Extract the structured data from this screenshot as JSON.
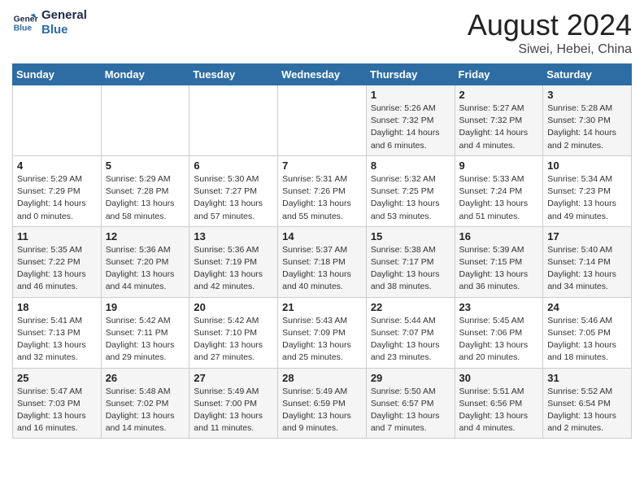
{
  "logo": {
    "line1": "General",
    "line2": "Blue"
  },
  "title": "August 2024",
  "location": "Siwei, Hebei, China",
  "weekdays": [
    "Sunday",
    "Monday",
    "Tuesday",
    "Wednesday",
    "Thursday",
    "Friday",
    "Saturday"
  ],
  "weeks": [
    [
      {
        "day": "",
        "info": ""
      },
      {
        "day": "",
        "info": ""
      },
      {
        "day": "",
        "info": ""
      },
      {
        "day": "",
        "info": ""
      },
      {
        "day": "1",
        "info": "Sunrise: 5:26 AM\nSunset: 7:32 PM\nDaylight: 14 hours\nand 6 minutes."
      },
      {
        "day": "2",
        "info": "Sunrise: 5:27 AM\nSunset: 7:32 PM\nDaylight: 14 hours\nand 4 minutes."
      },
      {
        "day": "3",
        "info": "Sunrise: 5:28 AM\nSunset: 7:30 PM\nDaylight: 14 hours\nand 2 minutes."
      }
    ],
    [
      {
        "day": "4",
        "info": "Sunrise: 5:29 AM\nSunset: 7:29 PM\nDaylight: 14 hours\nand 0 minutes."
      },
      {
        "day": "5",
        "info": "Sunrise: 5:29 AM\nSunset: 7:28 PM\nDaylight: 13 hours\nand 58 minutes."
      },
      {
        "day": "6",
        "info": "Sunrise: 5:30 AM\nSunset: 7:27 PM\nDaylight: 13 hours\nand 57 minutes."
      },
      {
        "day": "7",
        "info": "Sunrise: 5:31 AM\nSunset: 7:26 PM\nDaylight: 13 hours\nand 55 minutes."
      },
      {
        "day": "8",
        "info": "Sunrise: 5:32 AM\nSunset: 7:25 PM\nDaylight: 13 hours\nand 53 minutes."
      },
      {
        "day": "9",
        "info": "Sunrise: 5:33 AM\nSunset: 7:24 PM\nDaylight: 13 hours\nand 51 minutes."
      },
      {
        "day": "10",
        "info": "Sunrise: 5:34 AM\nSunset: 7:23 PM\nDaylight: 13 hours\nand 49 minutes."
      }
    ],
    [
      {
        "day": "11",
        "info": "Sunrise: 5:35 AM\nSunset: 7:22 PM\nDaylight: 13 hours\nand 46 minutes."
      },
      {
        "day": "12",
        "info": "Sunrise: 5:36 AM\nSunset: 7:20 PM\nDaylight: 13 hours\nand 44 minutes."
      },
      {
        "day": "13",
        "info": "Sunrise: 5:36 AM\nSunset: 7:19 PM\nDaylight: 13 hours\nand 42 minutes."
      },
      {
        "day": "14",
        "info": "Sunrise: 5:37 AM\nSunset: 7:18 PM\nDaylight: 13 hours\nand 40 minutes."
      },
      {
        "day": "15",
        "info": "Sunrise: 5:38 AM\nSunset: 7:17 PM\nDaylight: 13 hours\nand 38 minutes."
      },
      {
        "day": "16",
        "info": "Sunrise: 5:39 AM\nSunset: 7:15 PM\nDaylight: 13 hours\nand 36 minutes."
      },
      {
        "day": "17",
        "info": "Sunrise: 5:40 AM\nSunset: 7:14 PM\nDaylight: 13 hours\nand 34 minutes."
      }
    ],
    [
      {
        "day": "18",
        "info": "Sunrise: 5:41 AM\nSunset: 7:13 PM\nDaylight: 13 hours\nand 32 minutes."
      },
      {
        "day": "19",
        "info": "Sunrise: 5:42 AM\nSunset: 7:11 PM\nDaylight: 13 hours\nand 29 minutes."
      },
      {
        "day": "20",
        "info": "Sunrise: 5:42 AM\nSunset: 7:10 PM\nDaylight: 13 hours\nand 27 minutes."
      },
      {
        "day": "21",
        "info": "Sunrise: 5:43 AM\nSunset: 7:09 PM\nDaylight: 13 hours\nand 25 minutes."
      },
      {
        "day": "22",
        "info": "Sunrise: 5:44 AM\nSunset: 7:07 PM\nDaylight: 13 hours\nand 23 minutes."
      },
      {
        "day": "23",
        "info": "Sunrise: 5:45 AM\nSunset: 7:06 PM\nDaylight: 13 hours\nand 20 minutes."
      },
      {
        "day": "24",
        "info": "Sunrise: 5:46 AM\nSunset: 7:05 PM\nDaylight: 13 hours\nand 18 minutes."
      }
    ],
    [
      {
        "day": "25",
        "info": "Sunrise: 5:47 AM\nSunset: 7:03 PM\nDaylight: 13 hours\nand 16 minutes."
      },
      {
        "day": "26",
        "info": "Sunrise: 5:48 AM\nSunset: 7:02 PM\nDaylight: 13 hours\nand 14 minutes."
      },
      {
        "day": "27",
        "info": "Sunrise: 5:49 AM\nSunset: 7:00 PM\nDaylight: 13 hours\nand 11 minutes."
      },
      {
        "day": "28",
        "info": "Sunrise: 5:49 AM\nSunset: 6:59 PM\nDaylight: 13 hours\nand 9 minutes."
      },
      {
        "day": "29",
        "info": "Sunrise: 5:50 AM\nSunset: 6:57 PM\nDaylight: 13 hours\nand 7 minutes."
      },
      {
        "day": "30",
        "info": "Sunrise: 5:51 AM\nSunset: 6:56 PM\nDaylight: 13 hours\nand 4 minutes."
      },
      {
        "day": "31",
        "info": "Sunrise: 5:52 AM\nSunset: 6:54 PM\nDaylight: 13 hours\nand 2 minutes."
      }
    ]
  ]
}
